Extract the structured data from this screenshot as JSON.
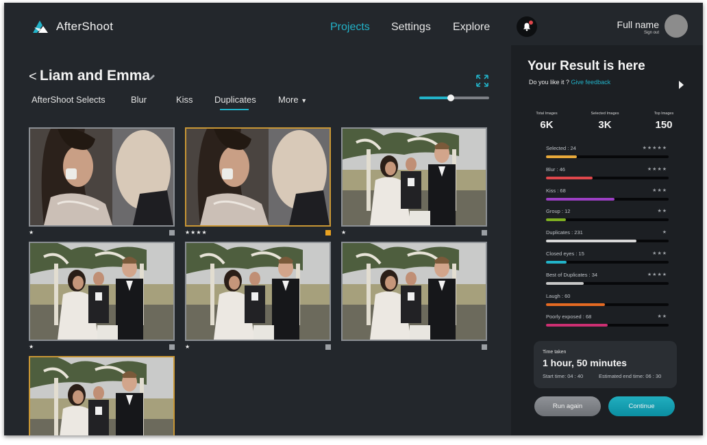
{
  "header": {
    "app_name": "AfterShoot",
    "nav": [
      {
        "label": "Projects",
        "active": true
      },
      {
        "label": "Settings",
        "active": false
      },
      {
        "label": "Explore",
        "active": false
      }
    ],
    "user_name": "Full name",
    "sign_out": "Sign out",
    "accent": "#22b3c9"
  },
  "project": {
    "back_glyph": "<",
    "title": "Liam and Emma",
    "tabs": [
      "AfterShoot Selects",
      "Blur",
      "Kiss",
      "Duplicates",
      "More"
    ],
    "active_tab": "Duplicates",
    "zoom_fraction": 0.45
  },
  "grid": {
    "images": [
      {
        "scene": "close-up",
        "rating": "★",
        "selected": false
      },
      {
        "scene": "close-up",
        "rating": "★★★★",
        "selected": true
      },
      {
        "scene": "ceremony",
        "rating": "★",
        "selected": false
      },
      {
        "scene": "ceremony",
        "rating": "★",
        "selected": false
      },
      {
        "scene": "ceremony",
        "rating": "★",
        "selected": false
      },
      {
        "scene": "ceremony",
        "rating": "",
        "selected": false
      },
      {
        "scene": "ceremony",
        "rating": "",
        "selected": true
      }
    ]
  },
  "result": {
    "title": "Your Result is here",
    "question": "Do you like it ?",
    "feedback_link": "Give feedback",
    "stats": [
      {
        "label": "Total Images",
        "value": "6K"
      },
      {
        "label": "Selected Images",
        "value": "3K"
      },
      {
        "label": "Top Images",
        "value": "150"
      }
    ],
    "categories": [
      {
        "label": "Selected : 24",
        "stars": "★★★★★",
        "fill": 0.25,
        "color": "#e8a93a"
      },
      {
        "label": "Blur : 46",
        "stars": "★★★★",
        "fill": 0.38,
        "color": "#e0474c"
      },
      {
        "label": "Kiss : 68",
        "stars": "★★★",
        "fill": 0.56,
        "color": "#9c3fc4"
      },
      {
        "label": "Group : 12",
        "stars": "★★",
        "fill": 0.16,
        "color": "#7fb021"
      },
      {
        "label": "Duplicates : 231",
        "stars": "★",
        "fill": 0.74,
        "color": "#d8d8d8"
      },
      {
        "label": "Closed eyes : 15",
        "stars": "★★★",
        "fill": 0.17,
        "color": "#22b3c9"
      },
      {
        "label": "Best of Duplicates : 34",
        "stars": "★★★★",
        "fill": 0.31,
        "color": "#c8c8c8"
      },
      {
        "label": "Laugh : 60",
        "stars": "",
        "fill": 0.48,
        "color": "#e56a22"
      },
      {
        "label": "Poorly exposed : 68",
        "stars": "★★",
        "fill": 0.5,
        "color": "#cc2f72"
      }
    ],
    "time": {
      "label": "Time taken",
      "value": "1 hour, 50 minutes",
      "start": "Start time: 04 : 40",
      "end": "Estimated end time: 06 : 30"
    },
    "buttons": {
      "run_again": "Run again",
      "continue": "Continue"
    }
  }
}
